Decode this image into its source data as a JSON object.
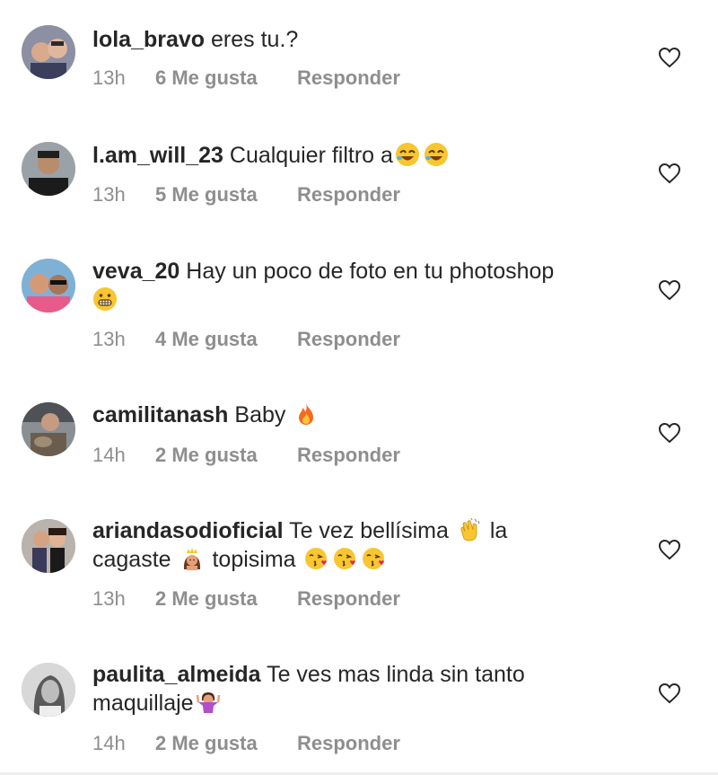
{
  "comments": [
    {
      "username": "lola_bravo",
      "text": "eres tu.?",
      "time": "13h",
      "likes": "6 Me gusta",
      "reply": "Responder"
    },
    {
      "username": "l.am_will_23",
      "text": "Cualquier filtro a",
      "time": "13h",
      "likes": "5 Me gusta",
      "reply": "Responder",
      "emojis": [
        "rofl",
        "rofl"
      ]
    },
    {
      "username": "veva_20",
      "text": "Hay un poco de foto en tu photoshop",
      "time": "13h",
      "likes": "4 Me gusta",
      "reply": "Responder",
      "emojis": [
        "grimace"
      ]
    },
    {
      "username": "camilitanash",
      "text": "Baby",
      "time": "14h",
      "likes": "2 Me gusta",
      "reply": "Responder",
      "emojis": [
        "fire"
      ]
    },
    {
      "username": "ariandasodioficial",
      "text_part1": "Te vez bellísima",
      "text_part2": "la",
      "text_part3": "cagaste",
      "text_part4": "topisima",
      "time": "13h",
      "likes": "2 Me gusta",
      "reply": "Responder",
      "emojis": [
        "clap",
        "princess",
        "kiss",
        "kiss",
        "kiss"
      ]
    },
    {
      "username": "paulita_almeida",
      "text": "Te ves mas linda sin tanto maquillaje",
      "time": "14h",
      "likes": "2 Me gusta",
      "reply": "Responder",
      "emojis": [
        "shrug"
      ]
    }
  ],
  "icons": {
    "heart": "heart-outline-icon"
  },
  "colors": {
    "text": "#262626",
    "meta": "#8e8e8e"
  }
}
